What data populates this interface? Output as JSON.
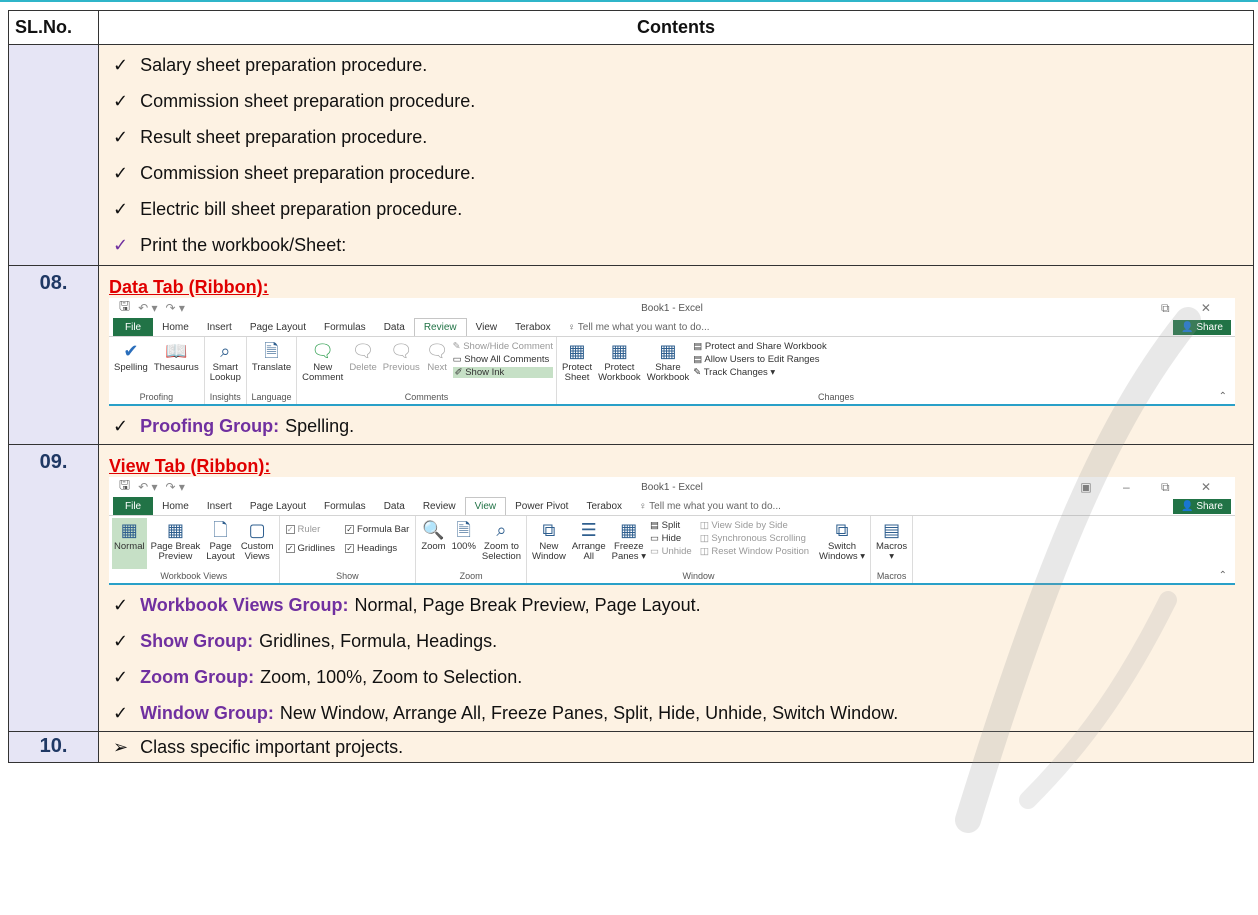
{
  "header": {
    "sl": "SL.No.",
    "contents": "Contents"
  },
  "rows": [
    {
      "items": [
        "Salary sheet preparation procedure.",
        "Commission sheet preparation procedure.",
        "Result sheet preparation procedure.",
        "Commission sheet preparation procedure.",
        "Electric bill sheet preparation procedure.",
        "Print the workbook/Sheet:"
      ]
    },
    {
      "sl": "08.",
      "title": "Data Tab (Ribbon):",
      "ribbon": {
        "app_title": "Book1 - Excel",
        "tabs": [
          "File",
          "Home",
          "Insert",
          "Page Layout",
          "Formulas",
          "Data",
          "Review",
          "View",
          "Terabox"
        ],
        "active_tab": "Review",
        "tellme": "Tell me what you want to do...",
        "share": "Share",
        "groups": {
          "proofing": {
            "name": "Proofing",
            "spelling": "Spelling",
            "thesaurus": "Thesaurus"
          },
          "insights": {
            "name": "Insights",
            "smart": "Smart",
            "lookup": "Lookup"
          },
          "language": {
            "name": "Language",
            "translate": "Translate"
          },
          "comments": {
            "name": "Comments",
            "new1": "New",
            "new2": "Comment",
            "delete": "Delete",
            "previous": "Previous",
            "next": "Next",
            "showhide": "Show/Hide Comment",
            "showall": "Show All Comments",
            "showink": "Show Ink"
          },
          "changes": {
            "name": "Changes",
            "protect_sheet1": "Protect",
            "protect_sheet2": "Sheet",
            "protect_wb1": "Protect",
            "protect_wb2": "Workbook",
            "share_wb1": "Share",
            "share_wb2": "Workbook",
            "protect_share": "Protect and Share Workbook",
            "allow_users": "Allow Users to Edit Ranges",
            "track": "Track Changes"
          }
        }
      },
      "note_label": "Proofing Group:",
      "note_text": "Spelling."
    },
    {
      "sl": "09.",
      "title": "View Tab (Ribbon):",
      "ribbon": {
        "app_title": "Book1 - Excel",
        "tabs": [
          "File",
          "Home",
          "Insert",
          "Page Layout",
          "Formulas",
          "Data",
          "Review",
          "View",
          "Power Pivot",
          "Terabox"
        ],
        "active_tab": "View",
        "tellme": "Tell me what you want to do...",
        "share": "Share",
        "groups": {
          "views": {
            "name": "Workbook Views",
            "normal": "Normal",
            "pbp1": "Page Break",
            "pbp2": "Preview",
            "pl1": "Page",
            "pl2": "Layout",
            "cv1": "Custom",
            "cv2": "Views"
          },
          "show": {
            "name": "Show",
            "ruler": "Ruler",
            "formula_bar": "Formula Bar",
            "gridlines": "Gridlines",
            "headings": "Headings"
          },
          "zoom": {
            "name": "Zoom",
            "zoom": "Zoom",
            "hundred": "100%",
            "zts1": "Zoom to",
            "zts2": "Selection"
          },
          "window": {
            "name": "Window",
            "nw1": "New",
            "nw2": "Window",
            "aa1": "Arrange",
            "aa2": "All",
            "fp1": "Freeze",
            "fp2": "Panes",
            "split": "Split",
            "hide": "Hide",
            "unhide": "Unhide",
            "vsbs": "View Side by Side",
            "sync": "Synchronous Scrolling",
            "reset": "Reset Window Position",
            "sw1": "Switch",
            "sw2": "Windows"
          },
          "macros": {
            "name": "Macros",
            "macros": "Macros"
          }
        }
      },
      "notes": [
        {
          "label": "Workbook Views Group:",
          "text": "Normal, Page Break Preview, Page Layout."
        },
        {
          "label": "Show Group:",
          "text": "Gridlines, Formula, Headings."
        },
        {
          "label": "Zoom Group:",
          "text": "Zoom, 100%, Zoom to Selection."
        },
        {
          "label": "Window Group:",
          "text": "New Window, Arrange All, Freeze Panes, Split, Hide, Unhide, Switch Window."
        }
      ]
    },
    {
      "sl": "10.",
      "items": [
        "Class specific important projects."
      ]
    }
  ]
}
